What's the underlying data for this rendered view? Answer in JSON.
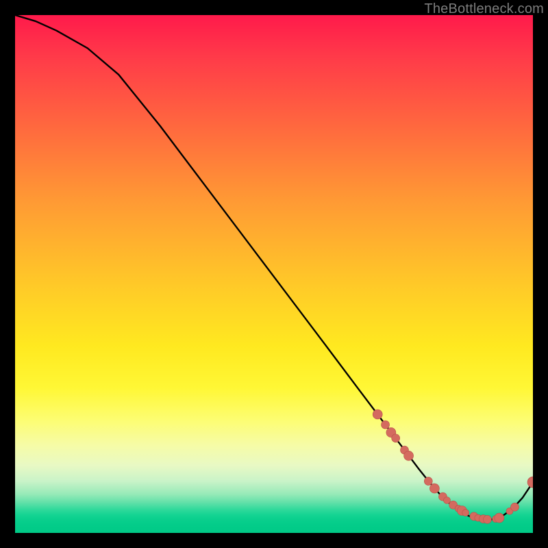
{
  "watermark": "TheBottleneck.com",
  "colors": {
    "background": "#000000",
    "curve": "#000000",
    "marker_fill": "#d46a5f",
    "marker_stroke": "#b85148"
  },
  "chart_data": {
    "type": "line",
    "title": "",
    "xlabel": "",
    "ylabel": "",
    "xlim": [
      0,
      100
    ],
    "ylim": [
      0,
      100
    ],
    "grid": false,
    "legend": false,
    "note": "Axes have no visible tick labels; values estimated from pixel positions on a 0-100 scale. y = bottleneck percentage (high=red, low=green).",
    "series": [
      {
        "name": "bottleneck-curve",
        "x": [
          0,
          4,
          8,
          14,
          20,
          28,
          36,
          44,
          52,
          60,
          66,
          70,
          74,
          78,
          80,
          82,
          84,
          86,
          88,
          90,
          92,
          94,
          96,
          98,
          100
        ],
        "y": [
          100,
          98.8,
          97.0,
          93.6,
          88.5,
          78.6,
          68.0,
          57.4,
          46.8,
          36.2,
          28.2,
          22.9,
          17.6,
          12.3,
          9.8,
          7.5,
          5.6,
          4.1,
          3.1,
          2.6,
          2.6,
          3.2,
          4.6,
          6.8,
          9.8
        ]
      }
    ],
    "markers": {
      "name": "highlighted-points",
      "x": [
        70.0,
        71.5,
        72.6,
        73.5,
        75.2,
        76.0,
        79.8,
        81.0,
        82.6,
        83.4,
        84.6,
        85.6,
        86.3,
        87.0,
        88.6,
        89.4,
        90.4,
        91.2,
        92.8,
        93.5,
        95.5,
        96.5,
        100.0
      ],
      "y": [
        22.9,
        20.9,
        19.4,
        18.3,
        16.0,
        14.9,
        10.0,
        8.6,
        7.0,
        6.3,
        5.4,
        4.7,
        4.3,
        3.9,
        3.2,
        2.9,
        2.7,
        2.6,
        2.7,
        2.9,
        4.2,
        5.0,
        9.8
      ],
      "radius": [
        7,
        6,
        7,
        6,
        6,
        7,
        6,
        7,
        6,
        5,
        6,
        5,
        7,
        5,
        6,
        5,
        6,
        6,
        5,
        7,
        5,
        6,
        8
      ]
    }
  }
}
